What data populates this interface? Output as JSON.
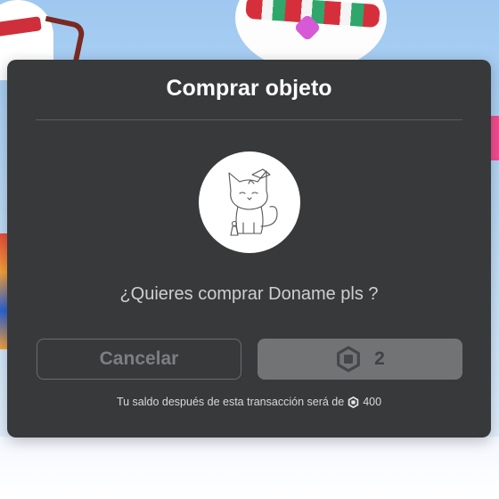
{
  "dialog": {
    "title": "Comprar objeto",
    "question": "¿Quieres comprar Doname pls ?",
    "cancel_label": "Cancelar",
    "price": "2",
    "balance_prefix": "Tu saldo después de esta transacción será de",
    "balance_value": "400"
  },
  "icons": {
    "currency": "robux-icon",
    "item": "item-thumbnail-cat-drawing"
  },
  "colors": {
    "modal_bg": "#38393b",
    "buy_button_disabled": "#727375",
    "cancel_text": "#7d7e82"
  }
}
